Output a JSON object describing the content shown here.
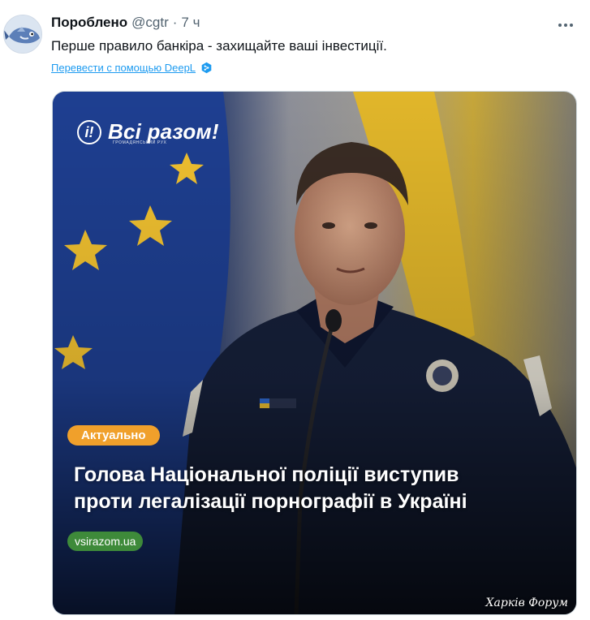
{
  "tweet": {
    "author_name": "Пороблено",
    "handle": "@cgtr",
    "separator": "·",
    "time": "7 ч",
    "text": "Перше правило банкіра - захищайте ваші інвестиції.",
    "translate_label": "Перевести с помощью DeepL",
    "more_icon": "more-horizontal-icon"
  },
  "media": {
    "logo_mark": "i!",
    "logo_text": "Всі разом!",
    "logo_sub": "громадянський рух",
    "badge": "Актуально",
    "headline": [
      "Голова Національної поліції виступив",
      "проти легалізації порнографії в Україні"
    ],
    "site": "vsirazom.ua",
    "watermark": "Харків Форум"
  },
  "colors": {
    "link": "#1d9bf0",
    "badge": "#f0a02b",
    "site_pill": "#3e8a3a",
    "eu_blue": "#1d3f8f",
    "uniform": "#16203a"
  }
}
